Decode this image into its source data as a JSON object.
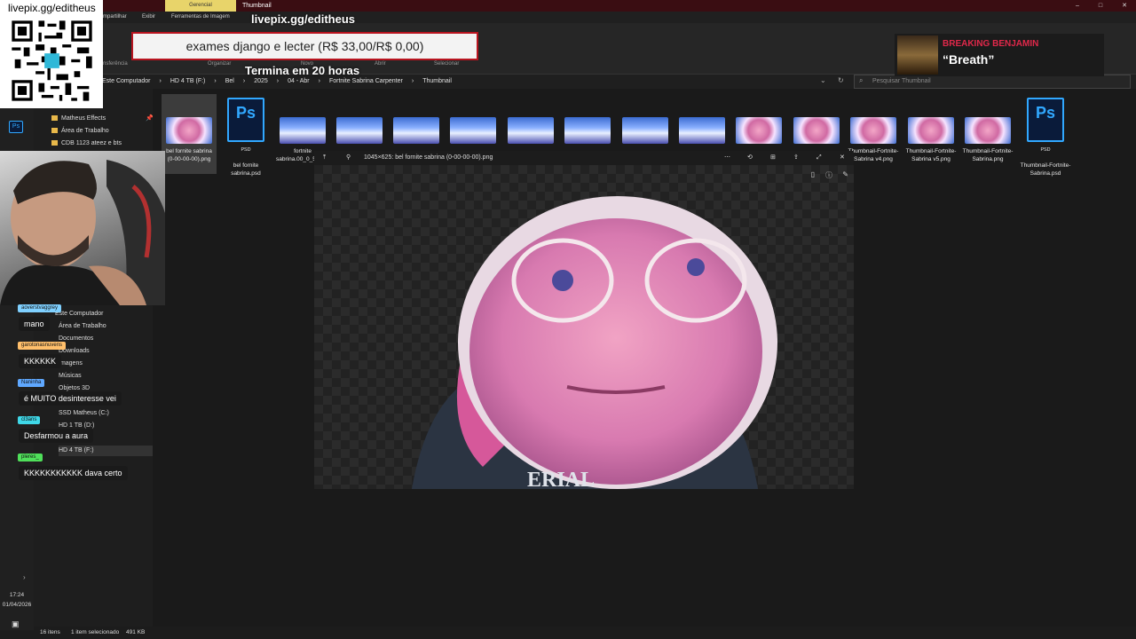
{
  "window": {
    "context_tab": "Gerencial",
    "title": "Thumbnail",
    "controls": [
      "–",
      "□",
      "✕"
    ]
  },
  "ribbon": {
    "tabs": [
      "mpartilhar",
      "Exibir",
      "Ferramentas de Imagem"
    ],
    "groups": [
      "nsferência",
      "Organizar",
      "Novo",
      "Abrir",
      "Selecionar"
    ]
  },
  "address": {
    "path": [
      "Este Computador",
      "HD 4 TB (F:)",
      "Bel",
      "2025",
      "04 - Abr",
      "Fortnite Sabrina Carpenter",
      "Thumbnail"
    ],
    "search_placeholder": "Pesquisar Thumbnail"
  },
  "sidebar": {
    "quick": [
      "Matheus Effects",
      "Área de Trabalho",
      "CDB 1123 ateez e bts"
    ],
    "tree": [
      "Este Computador",
      "Área de Trabalho",
      "Documentos",
      "Downloads",
      "Imagens",
      "Músicas",
      "Objetos 3D",
      "SSD Matheus (C:)",
      "HD 1 TB (D:)",
      "HD 4 TB (F:)"
    ]
  },
  "files": [
    {
      "name": "bel fornite sabrina (0-00-00-00).png",
      "kind": "face",
      "selected": true
    },
    {
      "name": "bel fornite sabrina.psd",
      "kind": "psd"
    },
    {
      "name": "fortnite sabrina.00_0_52.Still001...",
      "kind": "scene"
    },
    {
      "name": "",
      "kind": "scene"
    },
    {
      "name": "",
      "kind": "scene"
    },
    {
      "name": "",
      "kind": "scene"
    },
    {
      "name": "",
      "kind": "scene"
    },
    {
      "name": "",
      "kind": "scene"
    },
    {
      "name": "",
      "kind": "scene"
    },
    {
      "name": "",
      "kind": "scene"
    },
    {
      "name": "",
      "kind": "face"
    },
    {
      "name": "",
      "kind": "face"
    },
    {
      "name": "Thumbnail-Fortnite-Sabrina v4.png",
      "kind": "face"
    },
    {
      "name": "Thumbnail-Fortnite-Sabrina v5.png",
      "kind": "face"
    },
    {
      "name": "Thumbnail-Fortnite-Sabrina.png",
      "kind": "face"
    },
    {
      "name": "Thumbnail-Fortnite-Sabrina.psd",
      "kind": "psd"
    }
  ],
  "psd_label": "Ps",
  "psd_sub": "PSD",
  "preview": {
    "info": "1045×625: bel fornite sabrina (0-00-00-00).png",
    "shirt_text": "ERIAL"
  },
  "status": {
    "items": "16 itens",
    "selected": "1 item selecionado",
    "size": "491 KB"
  },
  "clock": {
    "time": "17:24",
    "date": "01/04/2026"
  },
  "overlay": {
    "livepix": "livepix.gg/editheus",
    "goal": "exames django e lecter (R$ 33,00/R$ 0,00)",
    "countdown": "Termina em 20 horas",
    "music_artist": "BREAKING BENJAMIN",
    "music_title": "“Breath”"
  },
  "chat": [
    {
      "user": "aoverstvaggrey",
      "color": "#7fd0ff",
      "msg": "mano"
    },
    {
      "user": "garotonasnuvens",
      "color": "#ffbf6b",
      "msg": "KKKKKK"
    },
    {
      "user": "Naninha",
      "color": "#5fa8ff",
      "msg": "é MUITO desinteresse vei"
    },
    {
      "user": "cl3ans",
      "color": "#3fd8e8",
      "msg": "Desfarmou a aura"
    },
    {
      "user": "pleres_",
      "color": "#4fe05a",
      "msg": "KKKKKKKKKKK dava certo"
    }
  ]
}
